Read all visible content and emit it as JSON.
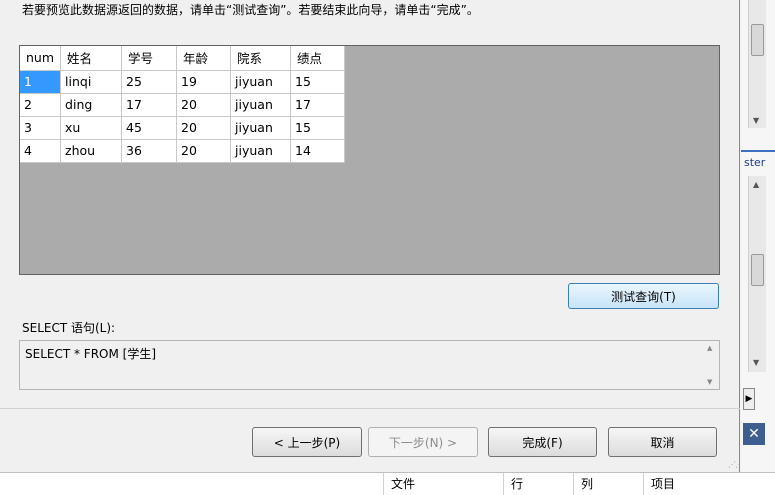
{
  "dialog": {
    "instruction": "若要预览此数据源返回的数据，请单击“测试查询”。若要结束此向导，请单击“完成”。",
    "grid": {
      "columns": [
        "num",
        "姓名",
        "学号",
        "年龄",
        "院系",
        "绩点"
      ],
      "rows": [
        [
          "1",
          "linqi",
          "25",
          "19",
          "jiyuan",
          "15"
        ],
        [
          "2",
          "ding",
          "17",
          "20",
          "jiyuan",
          "17"
        ],
        [
          "3",
          "xu",
          "45",
          "20",
          "jiyuan",
          "15"
        ],
        [
          "4",
          "zhou",
          "36",
          "20",
          "jiyuan",
          "14"
        ]
      ],
      "selected_cell": {
        "row": 0,
        "col": 0
      }
    },
    "test_query_button": "测试查询(T)",
    "sql_label": "SELECT 语句(L):",
    "sql_text": "SELECT * FROM [学生]",
    "buttons": {
      "back": "< 上一步(P)",
      "next": "下一步(N) >",
      "finish": "完成(F)",
      "cancel": "取消"
    }
  },
  "background": {
    "partial_text": "ster",
    "close_glyph": "✕",
    "bottom_columns": [
      "文件",
      "行",
      "列",
      "项目"
    ]
  }
}
